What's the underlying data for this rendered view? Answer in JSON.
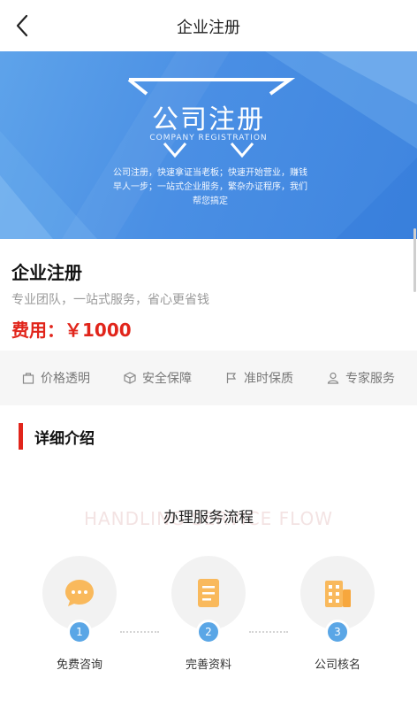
{
  "header": {
    "title": "企业注册",
    "back_icon": "chevron-left-icon"
  },
  "banner": {
    "title": "公司注册",
    "subtitle": "COMPANY REGISTRATION",
    "description": "公司注册，快速拿证当老板；快速开始营业，赚钱早人一步；一站式企业服务，繁杂办证程序，我们帮您搞定",
    "gradient_start": "#5ea3ea",
    "gradient_end": "#3f85df"
  },
  "product": {
    "name": "企业注册",
    "slogan": "专业团队，一站式服务，省心更省钱",
    "price": "费用：￥1000",
    "price_color": "#e1251b"
  },
  "features": [
    {
      "label": "价格透明",
      "icon": "bag-icon"
    },
    {
      "label": "安全保障",
      "icon": "cube-icon"
    },
    {
      "label": "准时保质",
      "icon": "flag-icon"
    },
    {
      "label": "专家服务",
      "icon": "person-icon"
    }
  ],
  "detail": {
    "section_title": "详细介绍",
    "flow_watermark": "HANDLING SERVICE FLOW",
    "flow_title": "办理服务流程",
    "steps": [
      {
        "number": "1",
        "label": "免费咨询",
        "icon": "chat-bubble-icon"
      },
      {
        "number": "2",
        "label": "完善资料",
        "icon": "document-icon"
      },
      {
        "number": "3",
        "label": "公司核名",
        "icon": "building-icon"
      }
    ],
    "accent_color": "#5aa6e6"
  }
}
